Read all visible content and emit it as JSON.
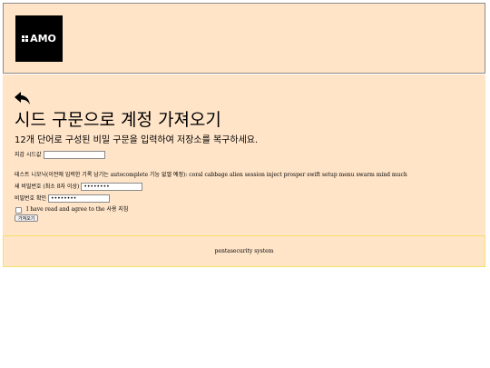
{
  "header": {
    "logo_text": "AMO"
  },
  "main": {
    "title": "시드 구문으로 계정 가져오기",
    "subtitle": "12개 단어로 구성된 비밀 구문을 입력하여 저장소를 복구하세요.",
    "wallet_seed_label": "지갑 시드값",
    "wallet_seed_value": "",
    "test_note": "테스트 니모닉(이전에 입력한 기록 남기는 autocomplete 기능 없앨 예정): coral cabbage alien session inject prosper swift setup menu swarm mind much",
    "new_password_label": "새 비밀번호 (최소 8자 이상)",
    "new_password_value": "••••••••",
    "confirm_password_label": "비밀번호 확인",
    "confirm_password_value": "••••••••",
    "agree_text": "I have read and agree to the 사용 지침",
    "import_button": "가져오기"
  },
  "footer": {
    "text": "pentasecurity system"
  },
  "colors": {
    "panel_bg": "#ffe4c8",
    "footer_border": "#f5e06a"
  }
}
